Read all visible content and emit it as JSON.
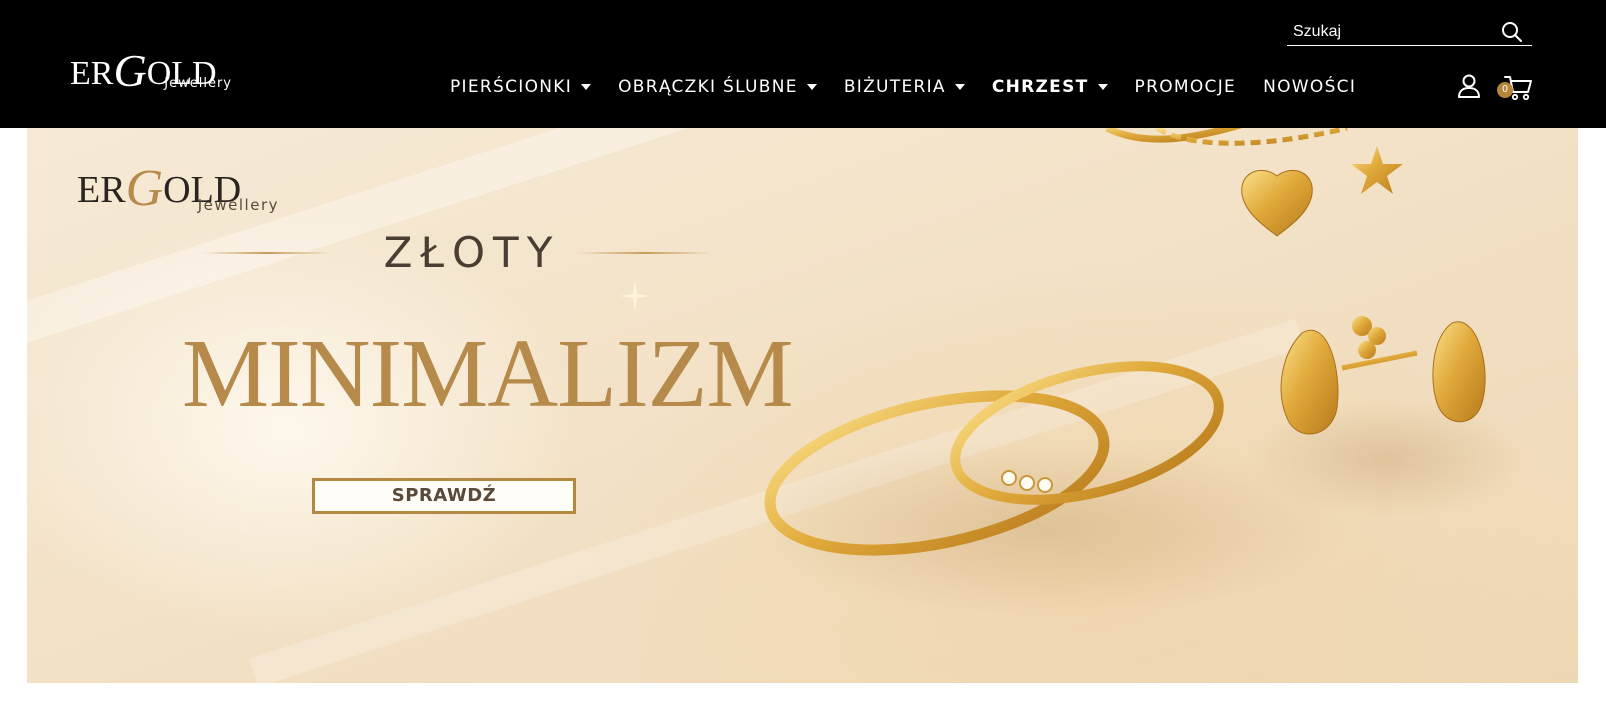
{
  "header": {
    "logo": {
      "main_prefix": "ER",
      "main_g": "G",
      "main_suffix": "OLD",
      "sub": "Jewellery"
    },
    "search": {
      "placeholder": "Szukaj"
    },
    "nav": [
      {
        "label": "PIERŚCIONKI",
        "has_dropdown": true,
        "bold": false
      },
      {
        "label": "OBRĄCZKI ŚLUBNE",
        "has_dropdown": true,
        "bold": false
      },
      {
        "label": "BIŻUTERIA",
        "has_dropdown": true,
        "bold": false
      },
      {
        "label": "CHRZEST",
        "has_dropdown": true,
        "bold": true
      },
      {
        "label": "PROMOCJE",
        "has_dropdown": false,
        "bold": false
      },
      {
        "label": "NOWOŚCI",
        "has_dropdown": false,
        "bold": false
      }
    ],
    "account_icon": "user-icon",
    "cart": {
      "icon": "cart-icon",
      "count": "0"
    }
  },
  "banner": {
    "logo": {
      "main_prefix": "ER",
      "main_g": "G",
      "main_suffix": "OLD",
      "sub": "Jewellery"
    },
    "subtitle": "ZŁOTY",
    "title": "MINIMALIZM",
    "button_label": "SPRAWDŹ"
  },
  "colors": {
    "header_bg": "#000000",
    "gold_accent": "#b68a4a",
    "badge": "#b5863a",
    "banner_bg": "#f3e2c7"
  }
}
